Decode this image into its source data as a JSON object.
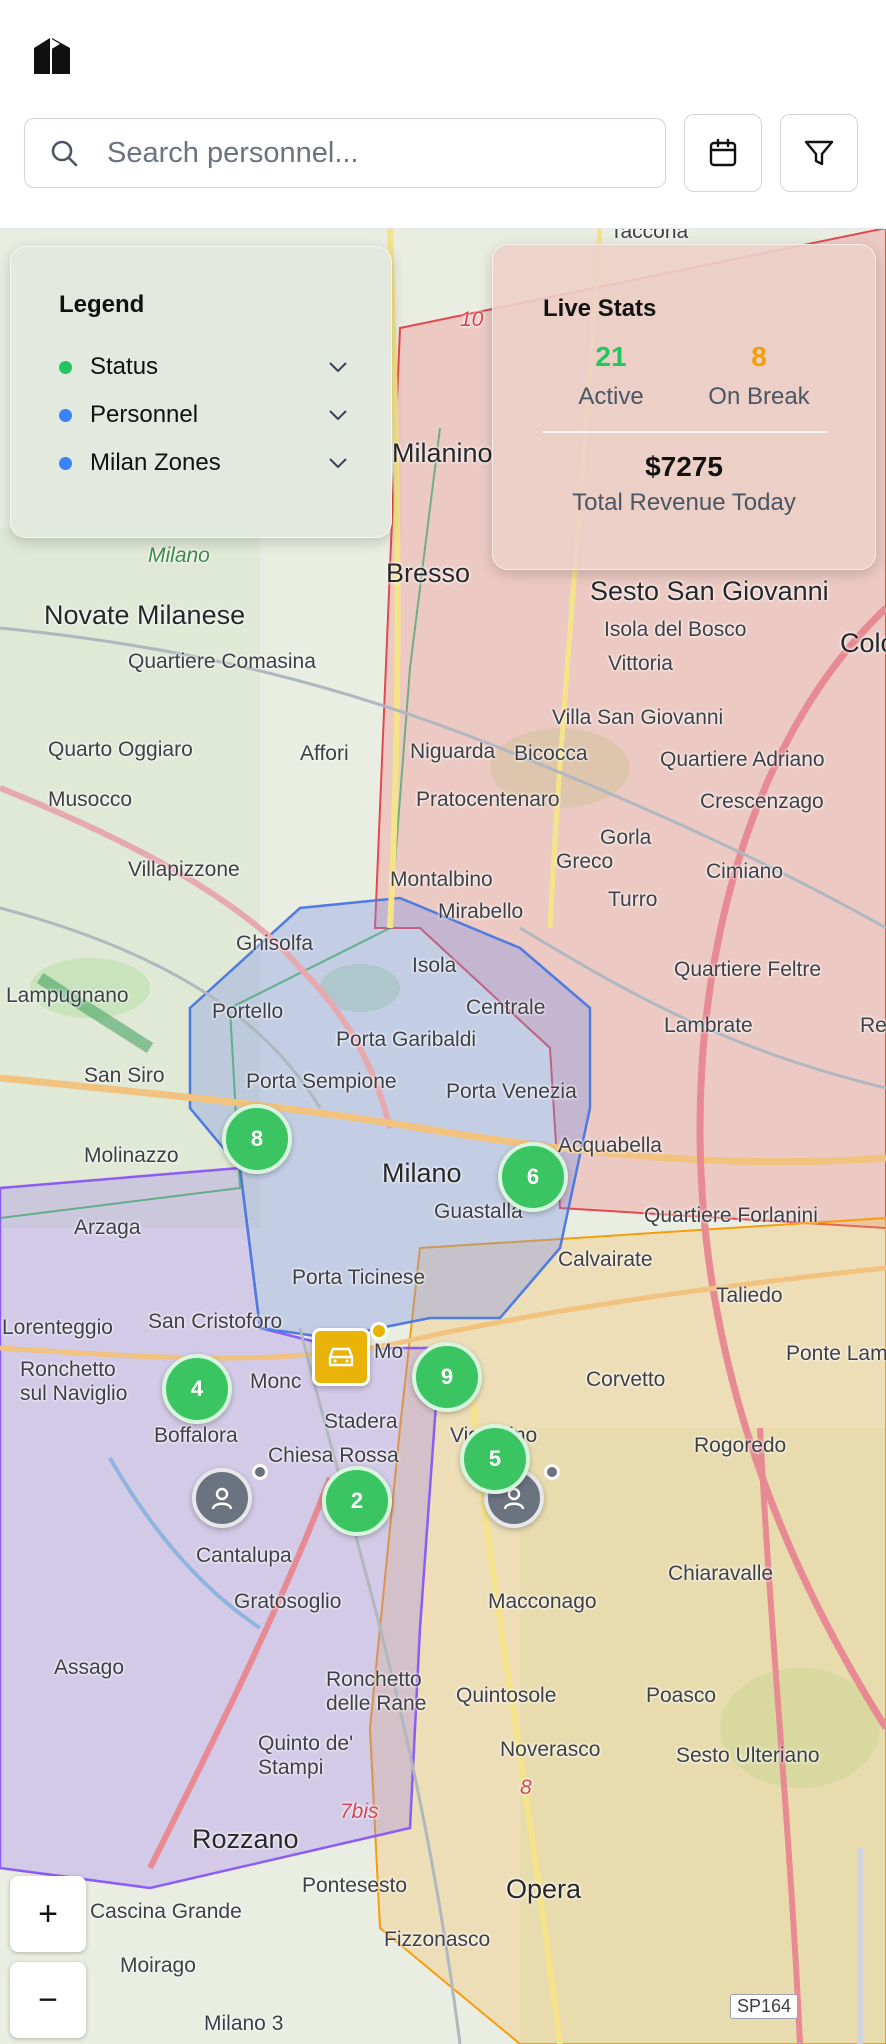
{
  "header": {
    "logo_icon": "building-blocks-logo",
    "search": {
      "placeholder": "Search personnel...",
      "value": ""
    },
    "calendar_icon": "calendar-icon",
    "filter_icon": "filter-icon"
  },
  "legend": {
    "title": "Legend",
    "items": [
      {
        "label": "Status",
        "color": "#22c55e"
      },
      {
        "label": "Personnel",
        "color": "#3b82f6"
      },
      {
        "label": "Milan Zones",
        "color": "#3b82f6"
      }
    ]
  },
  "live_stats": {
    "title": "Live Stats",
    "active_value": "21",
    "active_label": "Active",
    "active_color": "#22c55e",
    "break_value": "8",
    "break_label": "On Break",
    "break_color": "#f59e0b",
    "revenue_value": "$7275",
    "revenue_label": "Total Revenue Today"
  },
  "map": {
    "places": [
      "Taccona",
      "Milanino",
      "Bresso",
      "Sesto San Giovanni",
      "Isola del Bosco",
      "Novate Milanese",
      "Quartiere Comasina",
      "Vittoria",
      "Villa San Giovanni",
      "Quarto Oggiaro",
      "Affori",
      "Niguarda",
      "Bicocca",
      "Quartiere Adriano",
      "Musocco",
      "Pratocentenaro",
      "Crescenzago",
      "Villapizzone",
      "Gorla",
      "Cimiano",
      "Montalbino",
      "Greco",
      "Mirabello",
      "Turro",
      "Ghisolfa",
      "Isola",
      "Lampugnano",
      "Centrale",
      "Quartiere Feltre",
      "Portello",
      "Lambrate",
      "Porta Garibaldi",
      "San Siro",
      "Porta Sempione",
      "Porta Venezia",
      "Molinazzo",
      "Acquabella",
      "Milano",
      "Guastalla",
      "Quartiere Forlanini",
      "Arzaga",
      "Calvairate",
      "Taliedo",
      "Porta Ticinese",
      "Lorenteggio",
      "San Cristoforo",
      "Ronchetto sul Naviglio",
      "Corvetto",
      "Ponte Lambro",
      "Boffalora",
      "Stadera",
      "Chiesa Rossa",
      "Vigentino",
      "Rogoredo",
      "Cantalupa",
      "Chiaravalle",
      "Gratosoglio",
      "Macconago",
      "Assago",
      "Ronchetto delle Rane",
      "Quintosole",
      "Poasco",
      "Quinto de' Stampi",
      "Noverasco",
      "Sesto Ulteriano",
      "Rozzano",
      "Opera",
      "Cascina Grande",
      "Pontesesto",
      "Fizzonasco",
      "Moirago",
      "Milano 3",
      "Milano",
      "Colo",
      "Monc",
      "Mo",
      "Re",
      "SP164",
      "7bis",
      "8",
      "10"
    ],
    "clusters": [
      "8",
      "6",
      "4",
      "9",
      "5",
      "2"
    ],
    "person_icon": "person-icon",
    "vehicle_icon": "car-icon"
  },
  "zoom": {
    "in_label": "+",
    "out_label": "−"
  }
}
